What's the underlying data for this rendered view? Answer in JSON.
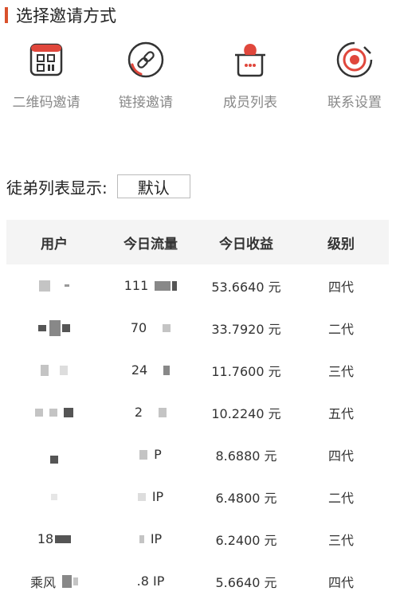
{
  "section": {
    "title": "选择邀请方式"
  },
  "methods": [
    {
      "label": "二维码邀请",
      "icon": "qr-code-icon"
    },
    {
      "label": "链接邀请",
      "icon": "link-icon"
    },
    {
      "label": "成员列表",
      "icon": "member-list-icon"
    },
    {
      "label": "联系设置",
      "icon": "contact-settings-icon"
    }
  ],
  "sort": {
    "label": "徒弟列表显示:",
    "value": "默认"
  },
  "table": {
    "headers": [
      "用户",
      "今日流量",
      "今日收益",
      "级别"
    ],
    "rows": [
      {
        "user": "",
        "traffic": "111",
        "earnings": "53.6640 元",
        "level": "四代"
      },
      {
        "user": "",
        "traffic": "70",
        "earnings": "33.7920 元",
        "level": "二代"
      },
      {
        "user": "",
        "traffic": "24",
        "earnings": "11.7600 元",
        "level": "三代"
      },
      {
        "user": "",
        "traffic": "2",
        "earnings": "10.2240 元",
        "level": "五代"
      },
      {
        "user": "",
        "traffic": "P",
        "earnings": "8.6880 元",
        "level": "四代"
      },
      {
        "user": "",
        "traffic": "IP",
        "earnings": "6.4800 元",
        "level": "二代"
      },
      {
        "user": "18",
        "traffic": "IP",
        "earnings": "6.2400 元",
        "level": "三代"
      },
      {
        "user": "乘风",
        "traffic": ".8 IP",
        "earnings": "5.6640 元",
        "level": "四代"
      }
    ]
  },
  "colors": {
    "accent": "#d9512c",
    "icon_red": "#e0473c",
    "icon_dark": "#333333"
  }
}
